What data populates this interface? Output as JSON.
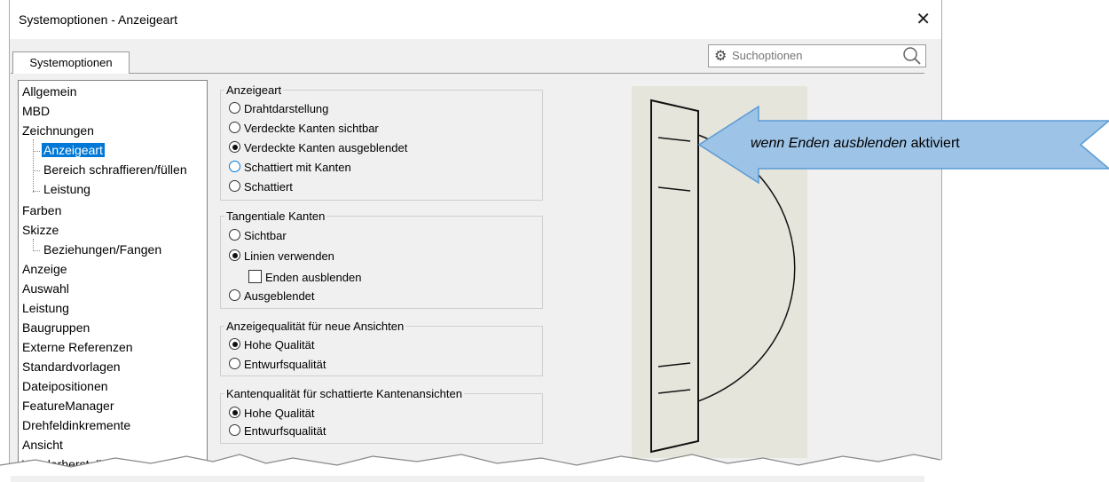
{
  "window": {
    "title": "Systemoptionen - Anzeigeart",
    "close_icon": "close-icon"
  },
  "search": {
    "placeholder": "Suchoptionen"
  },
  "tab": {
    "label": "Systemoptionen"
  },
  "tree": [
    {
      "label": "Allgemein"
    },
    {
      "label": "MBD"
    },
    {
      "label": "Zeichnungen"
    },
    {
      "label": "Anzeigeart",
      "selected": true
    },
    {
      "label": "Bereich schraffieren/füllen"
    },
    {
      "label": "Leistung"
    },
    {
      "label": "Farben"
    },
    {
      "label": "Skizze"
    },
    {
      "label": "Beziehungen/Fangen"
    },
    {
      "label": "Anzeige"
    },
    {
      "label": "Auswahl"
    },
    {
      "label": "Leistung"
    },
    {
      "label": "Baugruppen"
    },
    {
      "label": "Externe Referenzen"
    },
    {
      "label": "Standardvorlagen"
    },
    {
      "label": "Dateipositionen"
    },
    {
      "label": "FeatureManager"
    },
    {
      "label": "Drehfeldinkremente"
    },
    {
      "label": "Ansicht"
    },
    {
      "label": "Wiederherstellen"
    }
  ],
  "groups": {
    "anzeigeart": {
      "title": "Anzeigeart",
      "options": [
        "Drahtdarstellung",
        "Verdeckte Kanten sichtbar",
        "Verdeckte Kanten ausgeblendet",
        "Schattiert mit Kanten",
        "Schattiert"
      ],
      "selected": "Verdeckte Kanten ausgeblendet"
    },
    "tangential": {
      "title": "Tangentiale Kanten",
      "options": [
        "Sichtbar",
        "Linien verwenden",
        "Ausgeblendet"
      ],
      "selected": "Linien verwenden",
      "checkbox": {
        "label": "Enden ausblenden",
        "checked": false
      }
    },
    "qualitaet": {
      "title": "Anzeigequalität für neue Ansichten",
      "options": [
        "Hohe Qualität",
        "Entwurfsqualität"
      ],
      "selected": "Hohe Qualität"
    },
    "kanten": {
      "title": "Kantenqualität für schattierte Kantenansichten",
      "options": [
        "Hohe Qualität",
        "Entwurfsqualität"
      ],
      "selected": "Hohe Qualität"
    }
  },
  "callout": {
    "italic": "wenn Enden ausblenden",
    "rest": " aktiviert",
    "color": "#9dc3e6"
  }
}
